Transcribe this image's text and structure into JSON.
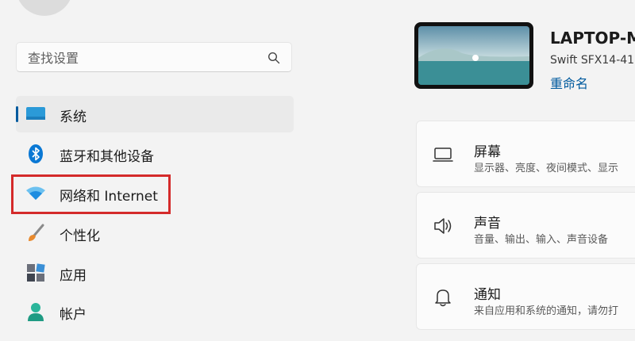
{
  "search": {
    "placeholder": "查找设置"
  },
  "sidebar": {
    "items": [
      {
        "label": "系统",
        "icon": "monitor-icon",
        "active": true
      },
      {
        "label": "蓝牙和其他设备",
        "icon": "bluetooth-icon",
        "active": false
      },
      {
        "label": "网络和 Internet",
        "icon": "wifi-icon",
        "active": false
      },
      {
        "label": "个性化",
        "icon": "brush-icon",
        "active": false
      },
      {
        "label": "应用",
        "icon": "apps-icon",
        "active": false
      },
      {
        "label": "帐户",
        "icon": "person-icon",
        "active": false
      }
    ]
  },
  "device": {
    "name": "LAPTOP-M",
    "model": "Swift SFX14-41",
    "rename_label": "重命名"
  },
  "cards": [
    {
      "title": "屏幕",
      "subtitle": "显示器、亮度、夜间模式、显示",
      "icon": "display-icon"
    },
    {
      "title": "声音",
      "subtitle": "音量、输出、输入、声音设备",
      "icon": "speaker-icon"
    },
    {
      "title": "通知",
      "subtitle": "来自应用和系统的通知，请勿打",
      "icon": "bell-icon"
    }
  ],
  "colors": {
    "accent": "#005a9e",
    "highlight": "#d42a2a",
    "background": "#f3f3f3"
  }
}
